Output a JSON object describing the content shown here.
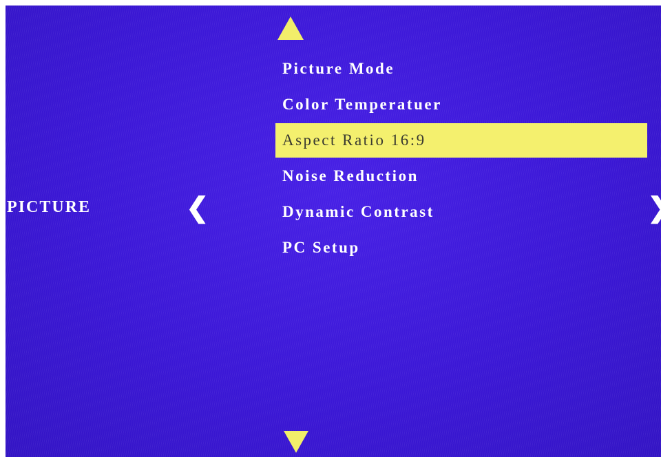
{
  "osd": {
    "section_title": "PICTURE",
    "nav": {
      "up_icon": "triangle-up-icon",
      "down_icon": "triangle-down-icon",
      "left_label": "❮",
      "right_label": "❯"
    },
    "menu": {
      "items": [
        {
          "label": "Picture Mode"
        },
        {
          "label": "Color Temperatuer"
        },
        {
          "label": "Aspect Ratio 16:9"
        },
        {
          "label": "Noise Reduction"
        },
        {
          "label": "Dynamic Contrast"
        },
        {
          "label": "PC Setup"
        }
      ],
      "selected_label": "Aspect Ratio 16:9"
    },
    "colors": {
      "background": "#3a18d8",
      "highlight": "#f4f06e",
      "arrow": "#f2ee6a",
      "text": "#ffffff"
    }
  }
}
